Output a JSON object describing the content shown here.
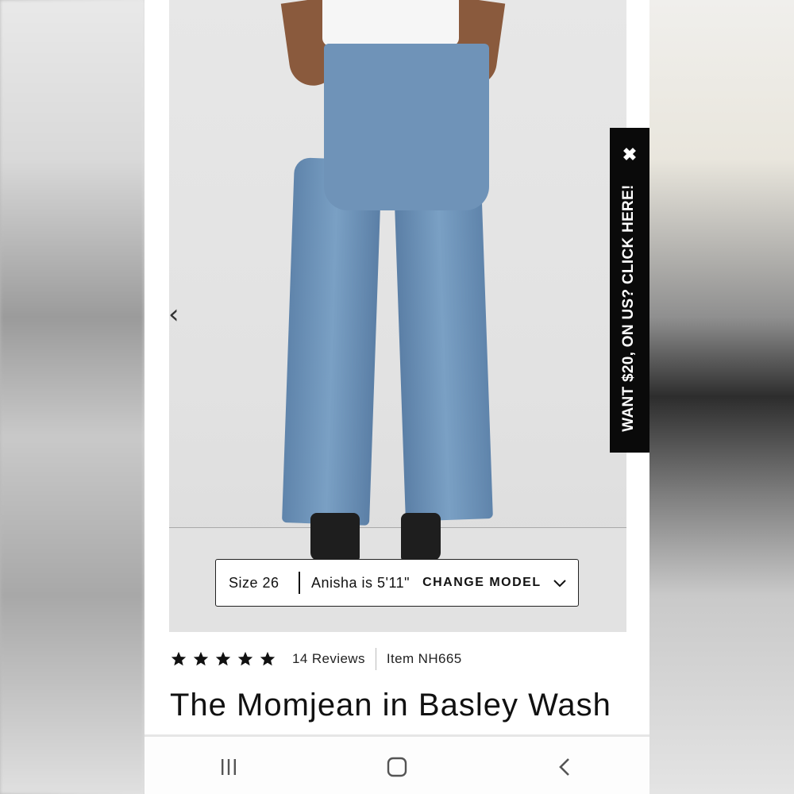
{
  "promo": {
    "text": "WANT $20, ON US? CLICK HERE!",
    "close_glyph": "✖"
  },
  "gallery": {
    "prev_glyph": "‹"
  },
  "model_bar": {
    "size_label": "Size 26",
    "model_info": "Anisha is 5'11\"",
    "change_model_label": "CHANGE MODEL"
  },
  "product": {
    "rating_stars": 5,
    "review_count": "14 Reviews",
    "item_number": "Item NH665",
    "title": "The Momjean in Basley Wash"
  },
  "colors": {
    "accent": "#0a0a0a",
    "text": "#111111",
    "denim": "#6f93b8"
  },
  "icons": {
    "recents": "recents-icon",
    "home": "home-icon",
    "back": "back-icon"
  }
}
